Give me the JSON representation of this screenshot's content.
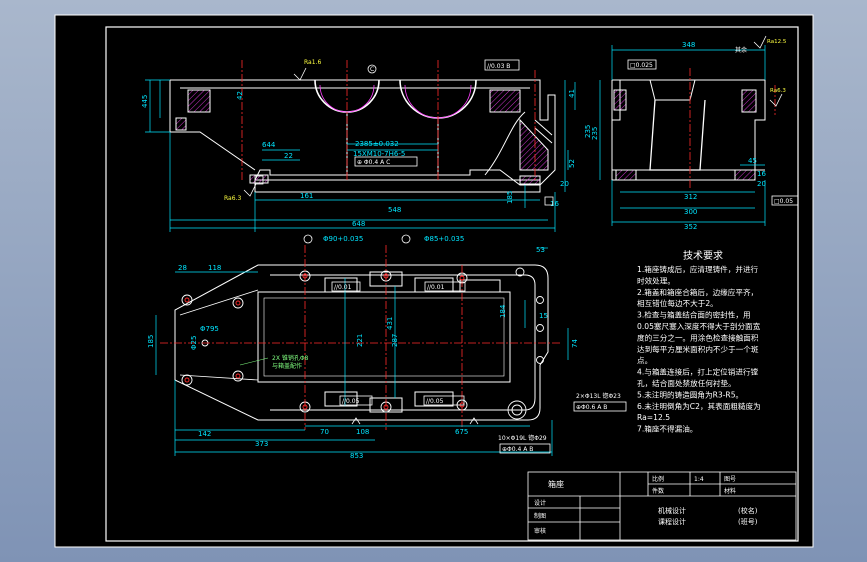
{
  "colors": {
    "background": "#000000",
    "outline": "#ffffff",
    "dimension": "#00e5ff",
    "centerline": "#ff2b2b",
    "hatch": "#ff40ff",
    "note": "#ffff40",
    "tolerance": "#80ff80"
  },
  "front_view": {
    "dims": {
      "overall_length": "648",
      "inner_length": "548",
      "left_offset": "161",
      "bearing_span": "2385±0.032",
      "bore_note": "15XM10-7H6-5",
      "left_wall": "644",
      "pocket": "22",
      "feet": "185",
      "height": "235",
      "flange_height": "445",
      "top_thickness": "41",
      "base_thick": "20",
      "right_height": "52",
      "foot_offset": "16"
    },
    "labels": {
      "datum_top": "Ra1.6",
      "datum_bottom": "Ra6.3",
      "circle_tag": "C",
      "flatness": "//0.03 B",
      "position": "⊕ Φ0.4 A C"
    }
  },
  "side_view": {
    "dims": {
      "overall_width": "348",
      "mid_width": "312",
      "base_width": "300",
      "foot_width": "352",
      "height_left": "235",
      "height_right": "45",
      "inner_height": "16",
      "bottom_height": "20"
    },
    "labels": {
      "flatness": "□0.025",
      "mating": "其余",
      "roughness": "Ra12.5",
      "roughness_right": "Ra6.3",
      "bottom_flat": "□0.05"
    }
  },
  "plan_view": {
    "dims": {
      "bore_left": "Φ90+0.035",
      "bore_right": "Φ85+0.035",
      "left_edge": "28",
      "left_span": "118",
      "corner_width": "53",
      "overall_length": "853",
      "mid_length": "373",
      "left_segment": "142",
      "hole_span": "70",
      "hole_span_2": "108",
      "right_segment": "675",
      "depth_a": "431",
      "depth_b": "221",
      "depth_c": "287",
      "depth_d": "184",
      "right_depth": "74",
      "left_depth": "185",
      "short_dim": "15",
      "note_a": "Φ795",
      "note_b": "Φ25"
    },
    "labels": {
      "bolt_note": "2X 锥销孔Φ8\n与箱盖配作",
      "hole_pattern": "2×Φ13L 锪Φ23",
      "hole_tol": "⊕Φ0.6 A B",
      "thread_note": "10×Φ19L 锪Φ29",
      "thread_tol": "⊕Φ0.4 A B",
      "tol_1": "//0.01",
      "tol_2": "//0.01",
      "tol_3": "//0.05",
      "tol_4": "//0.05"
    }
  },
  "requirements": {
    "title": "技术要求",
    "lines": [
      "1.箱座铸成后，应清理铸件，并进行",
      "时效处理。",
      "2.箱盖和箱座合箱后，边缘应平齐，",
      "相互错位每边不大于2。",
      "3.检查与箱盖结合面的密封性，用",
      "0.05塞尺塞入深度不得大于剖分面宽",
      "度的三分之一。用涂色检查接触面积",
      "达到每平方厘米面积内不少于一个斑",
      "点。",
      "4.与箱盖连接后，打上定位销进行镗",
      "孔，结合面处禁放任何衬垫。",
      "5.未注明的铸造圆角为R3-R5。",
      "6.未注明倒角为C2，其表面粗糙度为",
      "Ra=12.5",
      "7.箱座不得漏油。"
    ]
  },
  "title_block": {
    "part_name": "箱座",
    "scale_label": "比例",
    "scale_value": "1:4",
    "drawing_no_label": "图号",
    "qty_label": "件数",
    "material_label": "材料",
    "designer_label": "设计",
    "drawn_label": "制图",
    "checker_label": "审核",
    "course_1": "机械设计",
    "course_2": "课程设计",
    "school": "(校名)",
    "class_no": "(班号)"
  }
}
